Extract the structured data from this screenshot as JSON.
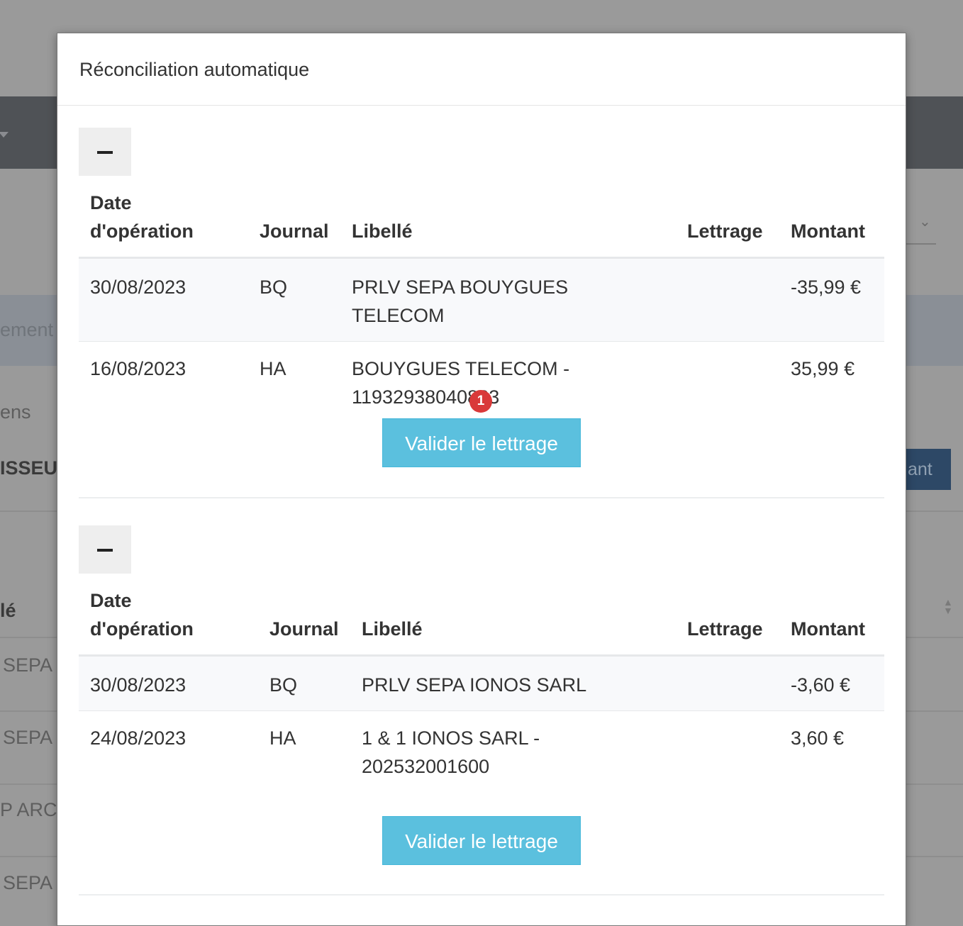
{
  "background": {
    "fragments": [
      "ement",
      "ens",
      "ISSEU",
      "ant",
      "lé",
      "SEPA",
      "SEPA",
      "P ARCH",
      "SEPA"
    ]
  },
  "modal": {
    "title": "Réconciliation automatique",
    "headers": {
      "date_line1": "Date",
      "date_line2": "d'opération",
      "journal": "Journal",
      "libelle": "Libellé",
      "lettrage": "Lettrage",
      "montant": "Montant"
    },
    "groups": [
      {
        "rows": [
          {
            "date": "30/08/2023",
            "journal": "BQ",
            "libelle": "PRLV SEPA BOUYGUES TELECOM",
            "lettrage": "",
            "montant": "-35,99 €"
          },
          {
            "date": "16/08/2023",
            "journal": "HA",
            "libelle_line1": "BOUYGUES TELECOM -",
            "libelle_line2": "11932938040823",
            "lettrage": "",
            "montant": "35,99 €"
          }
        ],
        "button": "Valider le lettrage",
        "badge": "1"
      },
      {
        "rows": [
          {
            "date": "30/08/2023",
            "journal": "BQ",
            "libelle": "PRLV SEPA IONOS SARL",
            "lettrage": "",
            "montant": "-3,60 €"
          },
          {
            "date": "24/08/2023",
            "journal": "HA",
            "libelle_line1": "1 & 1 IONOS SARL -",
            "libelle_line2": "202532001600",
            "lettrage": "",
            "montant": "3,60 €"
          }
        ],
        "button": "Valider le lettrage"
      }
    ]
  }
}
